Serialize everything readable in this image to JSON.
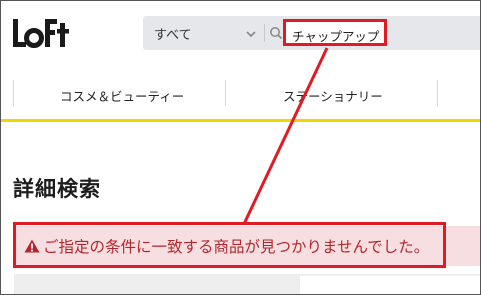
{
  "brand": {
    "logo_text": "LoFt"
  },
  "search": {
    "category_selected": "すべて",
    "query_value": "チャップアップ"
  },
  "nav": {
    "items": [
      {
        "label": "コスメ＆ビューティー"
      },
      {
        "label": "ステーショナリー"
      }
    ]
  },
  "main": {
    "page_title": "詳細検索",
    "alert_message": "ご指定の条件に一致する商品が見つかりませんでした。"
  },
  "colors": {
    "accent_yellow": "#f2d600",
    "highlight_red": "#e01b24",
    "alert_bg": "#f7dfe1",
    "alert_text": "#b4262e"
  },
  "icons": {
    "dropdown": "chevron-down-icon",
    "search": "search-icon",
    "alert": "warning-icon"
  }
}
